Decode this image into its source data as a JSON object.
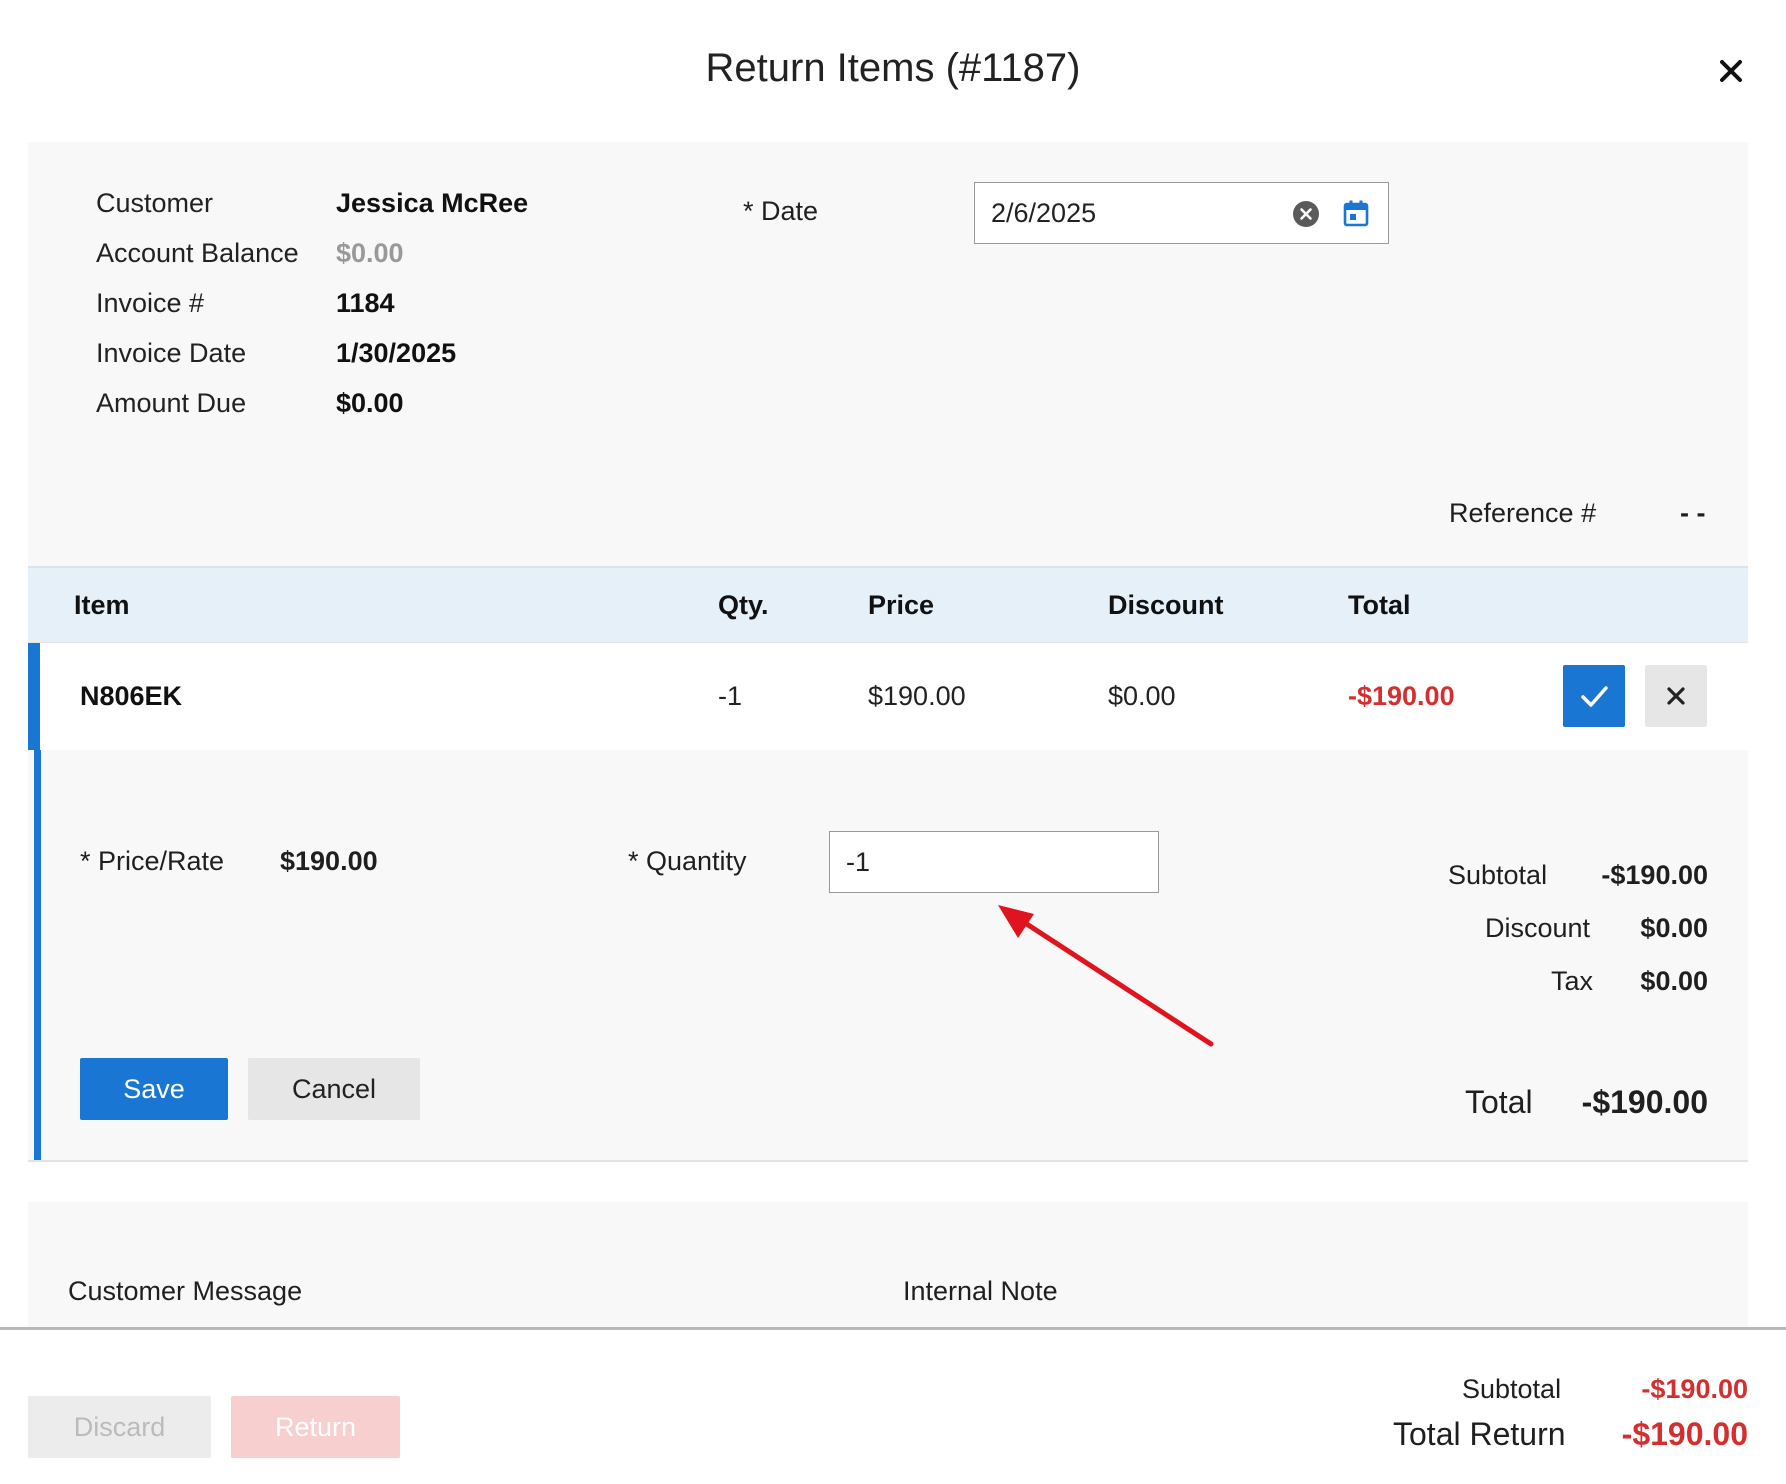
{
  "dialog": {
    "title": "Return Items (#1187)",
    "close_icon": "close-icon"
  },
  "info": {
    "customer_label": "Customer",
    "customer_value": "Jessica McRee",
    "balance_label": "Account Balance",
    "balance_value": "$0.00",
    "invoice_label": "Invoice #",
    "invoice_value": "1184",
    "invoice_date_label": "Invoice Date",
    "invoice_date_value": "1/30/2025",
    "amount_due_label": "Amount Due",
    "amount_due_value": "$0.00",
    "date_label": "* Date",
    "date_value": "2/6/2025",
    "reference_label": "Reference #",
    "reference_value": "- -"
  },
  "table": {
    "headers": [
      "Item",
      "Qty.",
      "Price",
      "Discount",
      "Total"
    ],
    "rows": [
      {
        "item": "N806EK",
        "qty": "-1",
        "price": "$190.00",
        "discount": "$0.00",
        "total": "-$190.00"
      }
    ]
  },
  "edit": {
    "price_label": "* Price/Rate",
    "price_value": "$190.00",
    "quantity_label": "* Quantity",
    "quantity_value": "-1",
    "subtotal_label": "Subtotal",
    "subtotal_value": "-$190.00",
    "discount_label": "Discount",
    "discount_value": "$0.00",
    "tax_label": "Tax",
    "tax_value": "$0.00",
    "total_label": "Total",
    "total_value": "-$190.00",
    "save_label": "Save",
    "cancel_label": "Cancel"
  },
  "messages": {
    "customer_message_label": "Customer Message",
    "internal_note_label": "Internal Note"
  },
  "footer": {
    "discard_label": "Discard",
    "return_label": "Return",
    "subtotal_label": "Subtotal",
    "subtotal_value": "-$190.00",
    "total_return_label": "Total Return",
    "total_return_value": "-$190.00"
  },
  "colors": {
    "accent": "#1976d2",
    "negative": "#d32f2f",
    "annotation_arrow": "#e0141e"
  }
}
